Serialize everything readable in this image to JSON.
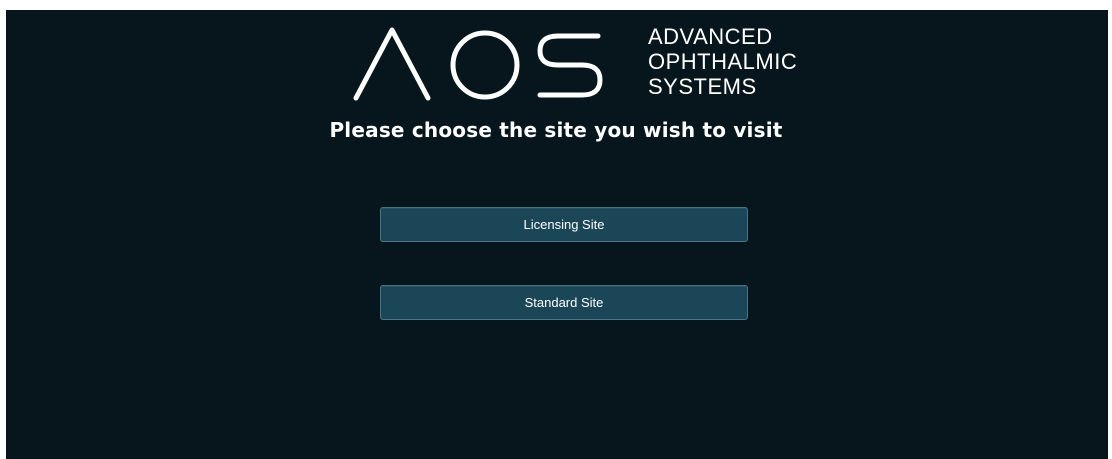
{
  "logo": {
    "mark_text": "AOS",
    "lines": [
      "ADVANCED",
      "OPHTHALMIC",
      "SYSTEMS"
    ]
  },
  "headline": "Please choose the site you wish to visit",
  "buttons": {
    "licensing": "Licensing Site",
    "standard": "Standard Site"
  },
  "colors": {
    "background": "#06161c",
    "button": "#1b4658",
    "button_border": "#4b7386",
    "text": "#ffffff"
  }
}
